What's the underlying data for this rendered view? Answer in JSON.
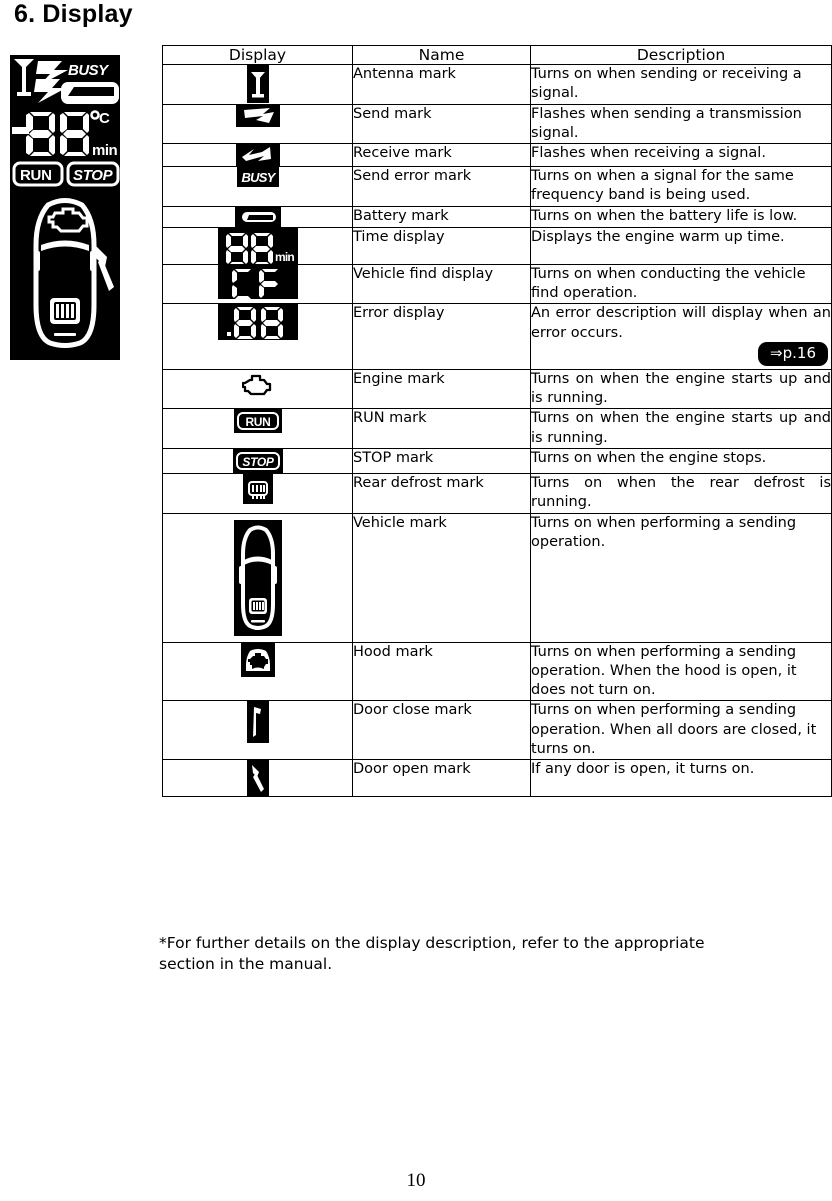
{
  "page": {
    "title": "6. Display",
    "number": "10",
    "footnote": "*For further details on the display description, refer to the appropriate section in the manual."
  },
  "lcd_panel": {
    "name": "lcd-display-illustration",
    "background_color": "#000000",
    "foreground_color": "#ffffff",
    "segments": [
      "antenna",
      "send",
      "receive",
      "BUSY",
      "battery",
      "-88",
      "°C",
      "min",
      "RUN",
      "STOP",
      "engine",
      "vehicle",
      "rear-defrost",
      "door-open"
    ],
    "text_labels": {
      "busy": "BUSY",
      "digits": "88",
      "minus": "-",
      "celsius": "°C",
      "min": "min",
      "run": "RUN",
      "stop": "STOP"
    }
  },
  "table": {
    "headers": [
      "Display",
      "Name",
      "Description"
    ],
    "rows": [
      {
        "icon": "antenna-mark-icon",
        "name": "Antenna mark",
        "description": "Turns on when sending or receiving a signal.",
        "justify": false
      },
      {
        "icon": "send-mark-icon",
        "name": "Send mark",
        "description": "Flashes when sending a transmission signal.",
        "justify": false
      },
      {
        "icon": "receive-mark-icon",
        "name": "Receive mark",
        "description": "Flashes when receiving a signal.",
        "justify": false
      },
      {
        "icon": "send-error-mark-icon",
        "name": "Send error mark",
        "description": "Turns on when a signal for the same frequency band is being used.",
        "justify": false
      },
      {
        "icon": "battery-mark-icon",
        "name": "Battery mark",
        "description": "Turns on when the battery life is low.",
        "justify": false
      },
      {
        "icon": "time-display-icon",
        "name": "Time display",
        "description": "Displays the engine warm up time.",
        "justify": false
      },
      {
        "icon": "vehicle-find-display-icon",
        "name": "Vehicle find display",
        "description": "Turns on when conducting the vehicle find operation.",
        "justify": false
      },
      {
        "icon": "error-display-icon",
        "name": "Error display",
        "description": "An error description will display when an error occurs.",
        "justify": true,
        "page_ref": "⇒p.16"
      },
      {
        "icon": "engine-mark-icon",
        "name": "Engine mark",
        "description": "Turns on when the engine starts up and is running.",
        "justify": true
      },
      {
        "icon": "run-mark-icon",
        "name": "RUN mark",
        "description": "Turns on when the engine starts up and is running.",
        "justify": true
      },
      {
        "icon": "stop-mark-icon",
        "name": "STOP mark",
        "description": "Turns on when the engine stops.",
        "justify": false
      },
      {
        "icon": "rear-defrost-mark-icon",
        "name": "Rear defrost mark",
        "description": "Turns on when the rear defrost is running.",
        "justify": true
      },
      {
        "icon": "vehicle-mark-icon",
        "name": "Vehicle mark",
        "description": "Turns on when performing a sending operation.",
        "justify": false
      },
      {
        "icon": "hood-mark-icon",
        "name": "Hood mark",
        "description": "Turns on when performing a sending operation. When the hood is open, it does not turn on.",
        "justify": false
      },
      {
        "icon": "door-close-mark-icon",
        "name": "Door close mark",
        "description": "Turns on when performing a sending operation. When all doors are closed, it turns on.",
        "justify": false
      },
      {
        "icon": "door-open-mark-icon",
        "name": "Door open mark",
        "description": "If any door is open, it turns on.",
        "justify": false
      }
    ]
  },
  "icon_labels": {
    "busy": "BUSY",
    "run": "RUN",
    "stop": "STOP",
    "time_digits": "88",
    "time_unit": "min",
    "vehicle_find": "CF",
    "error_digits": "88"
  }
}
